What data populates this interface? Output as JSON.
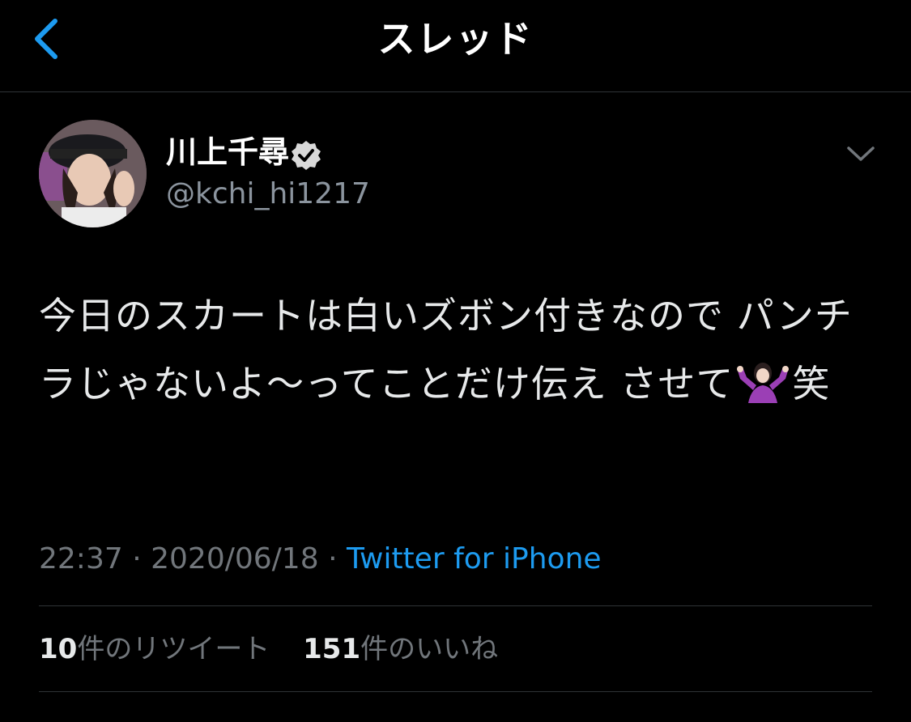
{
  "header": {
    "title": "スレッド",
    "back_icon": "chevron-left-icon"
  },
  "tweet": {
    "author": {
      "display_name": "川上千尋",
      "handle": "@kchi_hi1217",
      "verified": true
    },
    "text_part1": "今日のスカートは白いズボン付きなので パンチラじゃないよ〜ってことだけ伝え させて",
    "text_part2": "笑",
    "emoji": "person-shrugging-emoji",
    "time": "22:37",
    "date": "2020/06/18",
    "separator": "·",
    "source": "Twitter for iPhone",
    "retweets": {
      "count": "10",
      "label": "件のリツイート"
    },
    "likes": {
      "count": "151",
      "label": "件のいいね"
    }
  },
  "colors": {
    "background": "#000000",
    "accent": "#1d9bf0",
    "secondary_text": "#71767b",
    "divider": "#2f3336"
  }
}
